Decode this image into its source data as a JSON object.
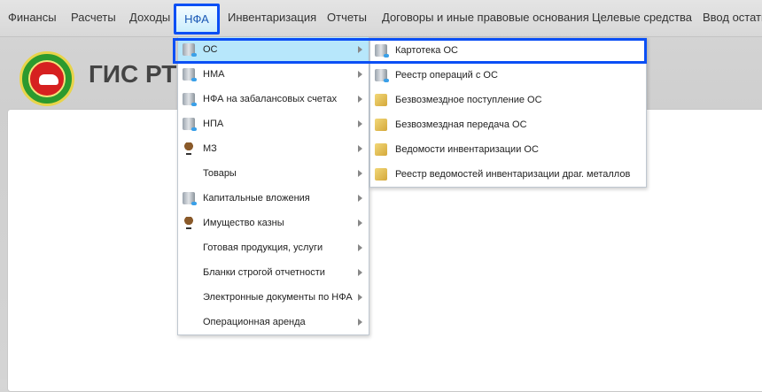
{
  "topmenu": [
    "Финансы",
    "Расчеты",
    "Доходы",
    "НФА",
    "Инвентаризация",
    "Отчеты",
    "Договоры и иные правовые основания",
    "Целевые средства",
    "Ввод остатко"
  ],
  "header": {
    "title": "ГИС РТ"
  },
  "nfa_menu": [
    {
      "label": "ОС",
      "icon": "server-icon"
    },
    {
      "label": "НМА",
      "icon": "server-icon"
    },
    {
      "label": "НФА на забалансовых счетах",
      "icon": "server-icon"
    },
    {
      "label": "НПА",
      "icon": "server-icon"
    },
    {
      "label": "МЗ",
      "icon": "chair-icon"
    },
    {
      "label": "Товары",
      "icon": ""
    },
    {
      "label": "Капитальные вложения",
      "icon": "server-icon"
    },
    {
      "label": "Имущество казны",
      "icon": "chair-icon"
    },
    {
      "label": "Готовая продукция, услуги",
      "icon": ""
    },
    {
      "label": "Бланки строгой отчетности",
      "icon": ""
    },
    {
      "label": "Электронные документы по НФА",
      "icon": ""
    },
    {
      "label": "Операционная аренда",
      "icon": ""
    }
  ],
  "os_submenu": [
    {
      "label": "Картотека ОС",
      "icon": "card-file-icon"
    },
    {
      "label": "Реестр операций с ОС",
      "icon": "registry-icon"
    },
    {
      "label": "Безвозмездное поступление ОС",
      "icon": "folder-icon"
    },
    {
      "label": "Безвозмездная передача ОС",
      "icon": "folder-icon"
    },
    {
      "label": "Ведомости инвентаризации ОС",
      "icon": "inventory-icon"
    },
    {
      "label": "Реестр ведомостей инвентаризации драг. металлов",
      "icon": "inventory-icon"
    }
  ]
}
